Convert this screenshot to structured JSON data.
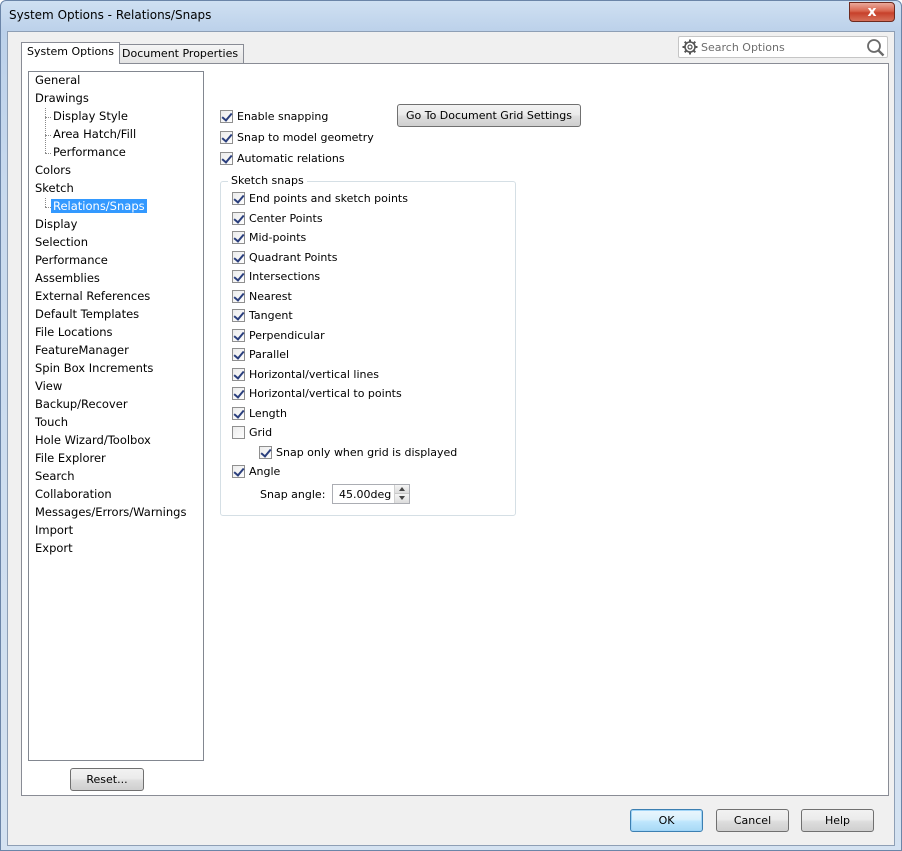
{
  "window": {
    "title": "System Options - Relations/Snaps",
    "close_glyph": "x"
  },
  "tabs": [
    {
      "label": "System Options",
      "active": true
    },
    {
      "label": "Document Properties",
      "active": false
    }
  ],
  "search": {
    "placeholder": "Search Options",
    "icon_left": "gear-icon",
    "icon_right": "magnifier-icon"
  },
  "tree": {
    "items": [
      {
        "label": "General",
        "level": 0
      },
      {
        "label": "Drawings",
        "level": 0
      },
      {
        "label": "Display Style",
        "level": 1
      },
      {
        "label": "Area Hatch/Fill",
        "level": 1
      },
      {
        "label": "Performance",
        "level": 1
      },
      {
        "label": "Colors",
        "level": 0
      },
      {
        "label": "Sketch",
        "level": 0
      },
      {
        "label": "Relations/Snaps",
        "level": 1,
        "selected": true
      },
      {
        "label": "Display",
        "level": 0
      },
      {
        "label": "Selection",
        "level": 0
      },
      {
        "label": "Performance",
        "level": 0
      },
      {
        "label": "Assemblies",
        "level": 0
      },
      {
        "label": "External References",
        "level": 0
      },
      {
        "label": "Default Templates",
        "level": 0
      },
      {
        "label": "File Locations",
        "level": 0
      },
      {
        "label": "FeatureManager",
        "level": 0
      },
      {
        "label": "Spin Box Increments",
        "level": 0
      },
      {
        "label": "View",
        "level": 0
      },
      {
        "label": "Backup/Recover",
        "level": 0
      },
      {
        "label": "Touch",
        "level": 0
      },
      {
        "label": "Hole Wizard/Toolbox",
        "level": 0
      },
      {
        "label": "File Explorer",
        "level": 0
      },
      {
        "label": "Search",
        "level": 0
      },
      {
        "label": "Collaboration",
        "level": 0
      },
      {
        "label": "Messages/Errors/Warnings",
        "level": 0
      },
      {
        "label": "Import",
        "level": 0
      },
      {
        "label": "Export",
        "level": 0
      }
    ]
  },
  "reset_label": "Reset...",
  "grid_button_label": "Go To Document Grid Settings",
  "top_options": [
    {
      "label": "Enable snapping",
      "checked": true
    },
    {
      "label": "Snap to model geometry",
      "checked": true
    },
    {
      "label": "Automatic relations",
      "checked": true
    }
  ],
  "sketch_snaps": {
    "title": "Sketch snaps",
    "items": [
      {
        "label": "End points and sketch points",
        "checked": true
      },
      {
        "label": "Center Points",
        "checked": true
      },
      {
        "label": "Mid-points",
        "checked": true
      },
      {
        "label": "Quadrant Points",
        "checked": true
      },
      {
        "label": "Intersections",
        "checked": true
      },
      {
        "label": "Nearest",
        "checked": true
      },
      {
        "label": "Tangent",
        "checked": true
      },
      {
        "label": "Perpendicular",
        "checked": true
      },
      {
        "label": "Parallel",
        "checked": true
      },
      {
        "label": "Horizontal/vertical lines",
        "checked": true
      },
      {
        "label": "Horizontal/vertical to points",
        "checked": true
      },
      {
        "label": "Length",
        "checked": true
      },
      {
        "label": "Grid",
        "checked": false
      }
    ],
    "grid_sub": {
      "label": "Snap only when grid is displayed",
      "checked": true
    },
    "angle": {
      "label": "Angle",
      "checked": true
    },
    "snap_angle_label": "Snap angle:",
    "snap_angle_value": "45.00deg"
  },
  "footer": {
    "ok": "OK",
    "cancel": "Cancel",
    "help": "Help"
  }
}
